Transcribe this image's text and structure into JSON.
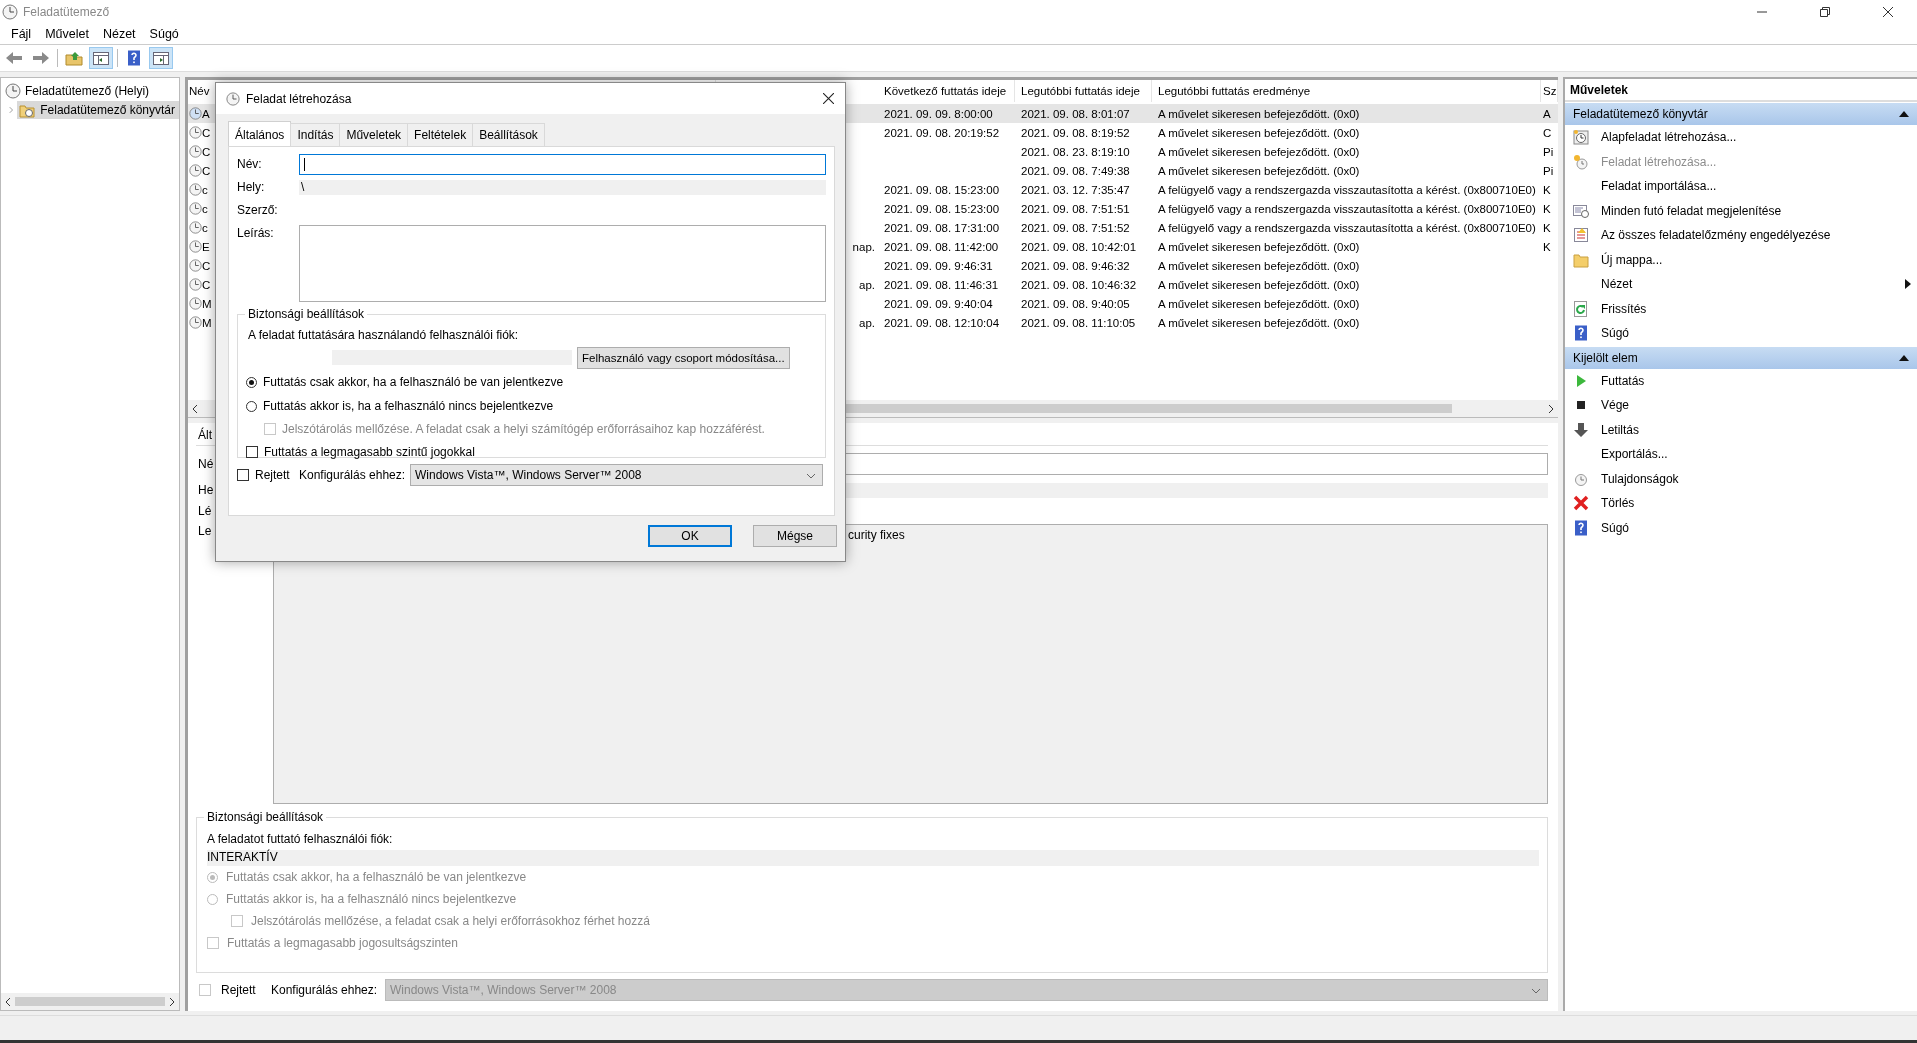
{
  "window": {
    "title": "Feladatütemező"
  },
  "menu": [
    {
      "label": "Fájl"
    },
    {
      "label": "Művelet"
    },
    {
      "label": "Nézet"
    },
    {
      "label": "Súgó"
    }
  ],
  "tree": [
    {
      "label": "Feladatütemező (Helyi)",
      "selected": false,
      "children": [
        {
          "label": "Feladatütemező könyvtár",
          "selected": true,
          "expanded": false
        }
      ]
    }
  ],
  "table": {
    "columns": [
      "Név",
      "Következő futtatás ideje",
      "Legutóbbi futtatás ideje",
      "Legutóbbi futtatás eredménye",
      "Sz"
    ],
    "rows": [
      {
        "name": "A",
        "next_run": "2021. 09. 09. 8:00:00",
        "last_run": "2021. 09. 08. 8:01:07",
        "result": "A művelet sikeresen befejeződött. (0x0)",
        "column_6": "A",
        "selected": true
      },
      {
        "name": "C",
        "next_run": "2021. 09. 08. 20:19:52",
        "last_run": "2021. 09. 08. 8:19:52",
        "result": "A művelet sikeresen befejeződött. (0x0)",
        "column_6": "C",
        "selected": false
      },
      {
        "name": "C",
        "last_run": "2021. 08. 23. 8:19:10",
        "result": "A művelet sikeresen befejeződött. (0x0)",
        "column_6": "Pi",
        "selected": false
      },
      {
        "name": "C",
        "last_run": "2021. 09. 08. 7:49:38",
        "result": "A művelet sikeresen befejeződött. (0x0)",
        "column_6": "Pi",
        "selected": false
      },
      {
        "name": "c",
        "next_run": "2021. 09. 08. 15:23:00",
        "last_run": "2021. 03. 12. 7:35:47",
        "result": "A felügyelő vagy a rendszergazda visszautasította a kérést. (0x800710E0)",
        "column_6": "K",
        "selected": false
      },
      {
        "name": "c",
        "next_run": "2021. 09. 08. 15:23:00",
        "last_run": "2021. 09. 08. 7:51:51",
        "result": "A felügyelő vagy a rendszergazda visszautasította a kérést. (0x800710E0)",
        "column_6": "K",
        "selected": false
      },
      {
        "name": "c",
        "next_run": "2021. 09. 08. 17:31:00",
        "last_run": "2021. 09. 08. 7:51:52",
        "result": "A felügyelő vagy a rendszergazda visszautasította a kérést. (0x800710E0)",
        "column_6": "K",
        "selected": false
      },
      {
        "name": "E",
        "column_2": "nap.",
        "next_run": "2021. 09. 08. 11:42:00",
        "last_run": "2021. 09. 08. 10:42:01",
        "result": "A művelet sikeresen befejeződött. (0x0)",
        "column_6": "K",
        "selected": false
      },
      {
        "name": "C",
        "next_run": "2021. 09. 09. 9:46:31",
        "last_run": "2021. 09. 08. 9:46:32",
        "result": "A művelet sikeresen befejeződött. (0x0)",
        "selected": false
      },
      {
        "name": "C",
        "column_2": "ap.",
        "next_run": "2021. 09. 08. 11:46:31",
        "last_run": "2021. 09. 08. 10:46:32",
        "result": "A művelet sikeresen befejeződött. (0x0)",
        "selected": false
      },
      {
        "name": "M",
        "next_run": "2021. 09. 09. 9:40:04",
        "last_run": "2021. 09. 08. 9:40:05",
        "result": "A művelet sikeresen befejeződött. (0x0)",
        "selected": false
      },
      {
        "name": "M",
        "column_2": "ap.",
        "next_run": "2021. 09. 08. 12:10:04",
        "last_run": "2021. 09. 08. 11:10:05",
        "result": "A művelet sikeresen befejeződött. (0x0)",
        "selected": false
      }
    ]
  },
  "details": {
    "tab": "Ált",
    "labels": [
      "Né",
      "He",
      "Lé",
      "Le"
    ],
    "description_fragment": "curity fixes",
    "security": {
      "title": "Biztonsági beállítások",
      "account_label": "A feladatot futtató felhasználói fiók:",
      "account_value": "INTERAKTÍV",
      "options": [
        {
          "kind": "radio",
          "label": "Futtatás csak akkor, ha a felhasználó be van jelentkezve",
          "checked": true,
          "disabled": true
        },
        {
          "kind": "radio",
          "label": "Futtatás akkor is, ha a felhasználó nincs bejelentkezve",
          "checked": false,
          "disabled": true,
          "children": [
            {
              "kind": "checkbox",
              "label": "Jelszótárolás mellőzése, a feladat csak a helyi erőforrásokhoz férhet hozzá",
              "checked": false,
              "disabled": true
            }
          ]
        },
        {
          "kind": "checkbox",
          "label": "Futtatás a legmagasabb jogosultságszinten",
          "checked": false,
          "disabled": true
        }
      ]
    },
    "hidden": {
      "label": "Rejtett",
      "checked": false,
      "disabled": true
    },
    "config_label": "Konfigurálás ehhez:",
    "config_value": "Windows Vista™, Windows Server™ 2008",
    "config_disabled": true
  },
  "actions": {
    "title": "Műveletek",
    "sections": [
      {
        "title": "Feladatütemező könyvtár",
        "expanded": true,
        "items": [
          {
            "label": "Alapfeladat létrehozása...",
            "disabled": false,
            "submenu": false
          },
          {
            "label": "Feladat létrehozása...",
            "disabled": true,
            "submenu": false
          },
          {
            "label": "Feladat importálása...",
            "disabled": false,
            "submenu": false
          },
          {
            "label": "Minden futó feladat megjelenítése",
            "disabled": false,
            "submenu": false
          },
          {
            "label": "Az összes feladatelőzmény engedélyezése",
            "disabled": false,
            "submenu": false
          },
          {
            "label": "Új mappa...",
            "disabled": false,
            "submenu": false
          },
          {
            "label": "Nézet",
            "disabled": false,
            "submenu": true
          },
          {
            "label": "Frissítés",
            "disabled": false,
            "submenu": false
          },
          {
            "label": "Súgó",
            "disabled": false,
            "submenu": false
          }
        ]
      },
      {
        "title": "Kijelölt elem",
        "expanded": true,
        "items": [
          {
            "label": "Futtatás",
            "disabled": false,
            "submenu": false
          },
          {
            "label": "Vége",
            "disabled": false,
            "submenu": false
          },
          {
            "label": "Letiltás",
            "disabled": false,
            "submenu": false
          },
          {
            "label": "Exportálás...",
            "disabled": false,
            "submenu": false
          },
          {
            "label": "Tulajdonságok",
            "disabled": false,
            "submenu": false
          },
          {
            "label": "Törlés",
            "disabled": false,
            "submenu": false
          },
          {
            "label": "Súgó",
            "disabled": false,
            "submenu": false
          }
        ]
      }
    ]
  },
  "dialog": {
    "title": "Feladat létrehozása",
    "tabs": [
      {
        "label": "Általános",
        "selected": true
      },
      {
        "label": "Indítás",
        "selected": false
      },
      {
        "label": "Műveletek",
        "selected": false
      },
      {
        "label": "Feltételek",
        "selected": false
      },
      {
        "label": "Beállítások",
        "selected": false
      }
    ],
    "name_label": "Név:",
    "location_label": "Hely:",
    "location_value": "\\",
    "author_label": "Szerző:",
    "description_label": "Leírás:",
    "security": {
      "title": "Biztonsági beállítások",
      "account_label": "A feladat futtatására használandó felhasználói fiók:",
      "change_button": "Felhasználó vagy csoport módosítása...",
      "options": [
        {
          "kind": "radio",
          "label": "Futtatás csak akkor, ha a felhasználó be van jelentkezve",
          "checked": true,
          "disabled": false
        },
        {
          "kind": "radio",
          "label": "Futtatás akkor is, ha a felhasználó nincs bejelentkezve",
          "checked": false,
          "disabled": false,
          "children": [
            {
              "kind": "checkbox",
              "label": "Jelszótárolás mellőzése. A feladat csak a helyi számítógép erőforrásaihoz kap hozzáférést.",
              "checked": false,
              "disabled": true
            }
          ]
        },
        {
          "kind": "checkbox",
          "label": "Futtatás a legmagasabb szintű jogokkal",
          "checked": false,
          "disabled": false
        }
      ]
    },
    "hidden": {
      "label": "Rejtett",
      "checked": false,
      "disabled": false
    },
    "config_label": "Konfigurálás ehhez:",
    "config_value": "Windows Vista™, Windows Server™ 2008",
    "config_disabled": false,
    "buttons": [
      {
        "label": "OK",
        "default": true
      },
      {
        "label": "Mégse",
        "default": false
      }
    ]
  }
}
